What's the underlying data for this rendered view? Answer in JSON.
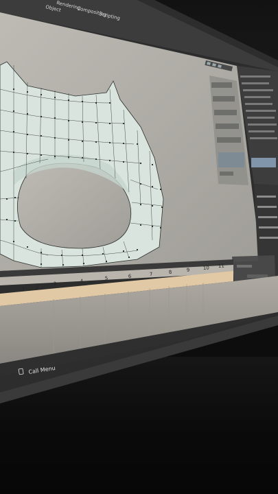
{
  "header": {
    "file_tab": "Object",
    "workspace_tabs": [
      "Rendering",
      "Compositing",
      "Scripting"
    ]
  },
  "timeline": {
    "frame_numbers": [
      "1",
      "2",
      "3",
      "4",
      "5",
      "6",
      "7",
      "8",
      "9",
      "10",
      "11"
    ]
  },
  "status_bar": {
    "call_menu_label": "Call Menu"
  },
  "colors": {
    "viewport_bg": "#b4b2ab",
    "mesh_fill": "#d9e6df",
    "mesh_wire": "#2b2f2d",
    "timeline_band": "#e2c9a5",
    "panel_bg": "#3a3a3a"
  }
}
